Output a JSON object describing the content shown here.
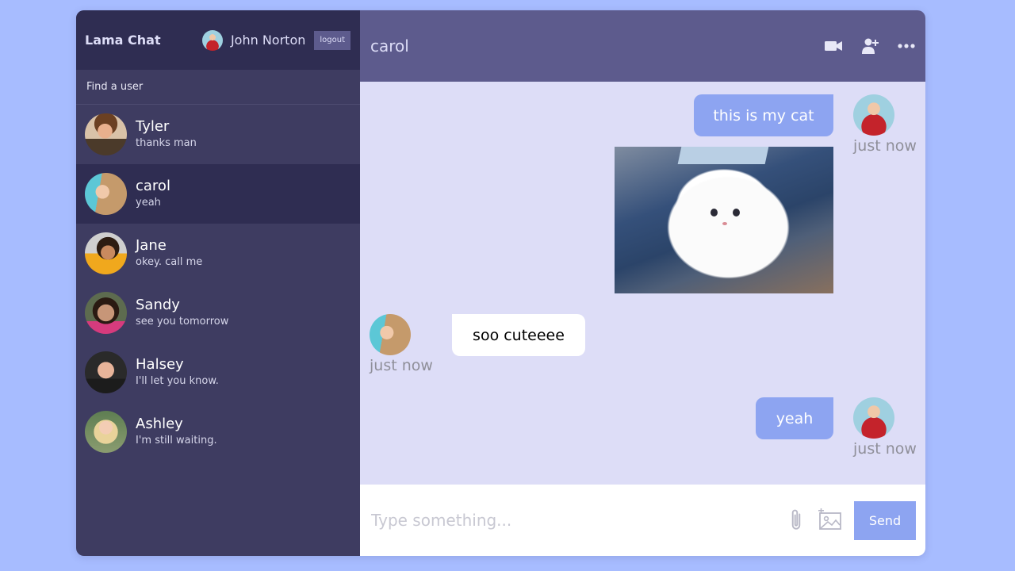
{
  "navbar": {
    "logo": "Lama Chat",
    "user_name": "John Norton",
    "logout_label": "logout"
  },
  "search": {
    "placeholder": "Find a user"
  },
  "chats": [
    {
      "name": "Tyler",
      "last_message": "thanks man",
      "active": false
    },
    {
      "name": "carol",
      "last_message": "yeah",
      "active": true
    },
    {
      "name": "Jane",
      "last_message": "okey. call me",
      "active": false
    },
    {
      "name": "Sandy",
      "last_message": "see you tomorrow",
      "active": false
    },
    {
      "name": "Halsey",
      "last_message": "I'll let you know.",
      "active": false
    },
    {
      "name": "Ashley",
      "last_message": "I'm still waiting.",
      "active": false
    }
  ],
  "chat_header": {
    "title": "carol",
    "icons": [
      "video-camera-icon",
      "add-user-icon",
      "more-options-icon"
    ]
  },
  "messages": [
    {
      "owner": true,
      "text": "this is my cat",
      "time": "just now",
      "has_image": true
    },
    {
      "owner": false,
      "text": "soo cuteeee",
      "time": "just now",
      "has_image": false
    },
    {
      "owner": true,
      "text": "yeah",
      "time": "just now",
      "has_image": false
    }
  ],
  "input": {
    "placeholder": "Type something...",
    "send_label": "Send",
    "icons": [
      "paperclip-icon",
      "add-image-icon"
    ]
  },
  "colors": {
    "background": "#a7bcff",
    "sidebar": "#3e3c61",
    "navbar": "#2f2d52",
    "header": "#5d5b8d",
    "messages_bg": "#ddddf7",
    "owner_bubble": "#8da4f1",
    "other_bubble": "#ffffff"
  }
}
